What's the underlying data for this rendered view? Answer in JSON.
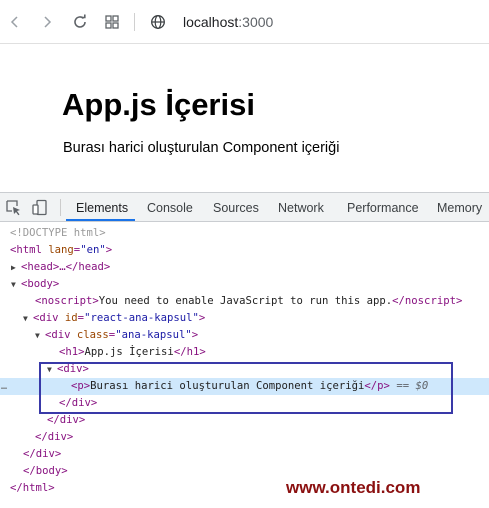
{
  "browser": {
    "url_host": "localhost",
    "url_port": ":3000",
    "icons": [
      "back-arrow-icon",
      "forward-arrow-icon",
      "reload-icon",
      "tab-grid-icon",
      "globe-icon"
    ]
  },
  "page": {
    "heading": "App.js İçerisi",
    "paragraph": "Burası harici oluşturulan Component içeriği"
  },
  "devtools": {
    "tabs": [
      "Elements",
      "Console",
      "Sources",
      "Network",
      "Performance",
      "Memory"
    ],
    "active_tab": "Elements",
    "dom": {
      "doctype": "<!DOCTYPE html>",
      "html_open_tag": "<html",
      "html_lang_attr": "lang",
      "html_lang_val": "\"en\"",
      "html_close_bracket": ">",
      "head_collapsed": "<head>…</head>",
      "body_open": "<body>",
      "noscript_open": "<noscript>",
      "noscript_text": "You need to enable JavaScript to run this app.",
      "noscript_close": "</noscript>",
      "div_open_tag": "<div",
      "id_attr": "id",
      "id_val": "\"react-ana-kapsul\"",
      "class_attr": "class",
      "class_val": "\"ana-kapsul\"",
      "gt": ">",
      "h1_open": "<h1>",
      "h1_text": "App.js İçerisi",
      "h1_close": "</h1>",
      "div_plain_open": "<div>",
      "p_open": "<p>",
      "p_text": "Burası harici oluşturulan Component içeriği",
      "p_close": "</p>",
      "selected_marker": "== $0",
      "div_close": "</div>",
      "body_close": "</body>",
      "html_close": "</html>",
      "gutter_dots": "…"
    }
  },
  "watermark": "www.ontedi.com"
}
